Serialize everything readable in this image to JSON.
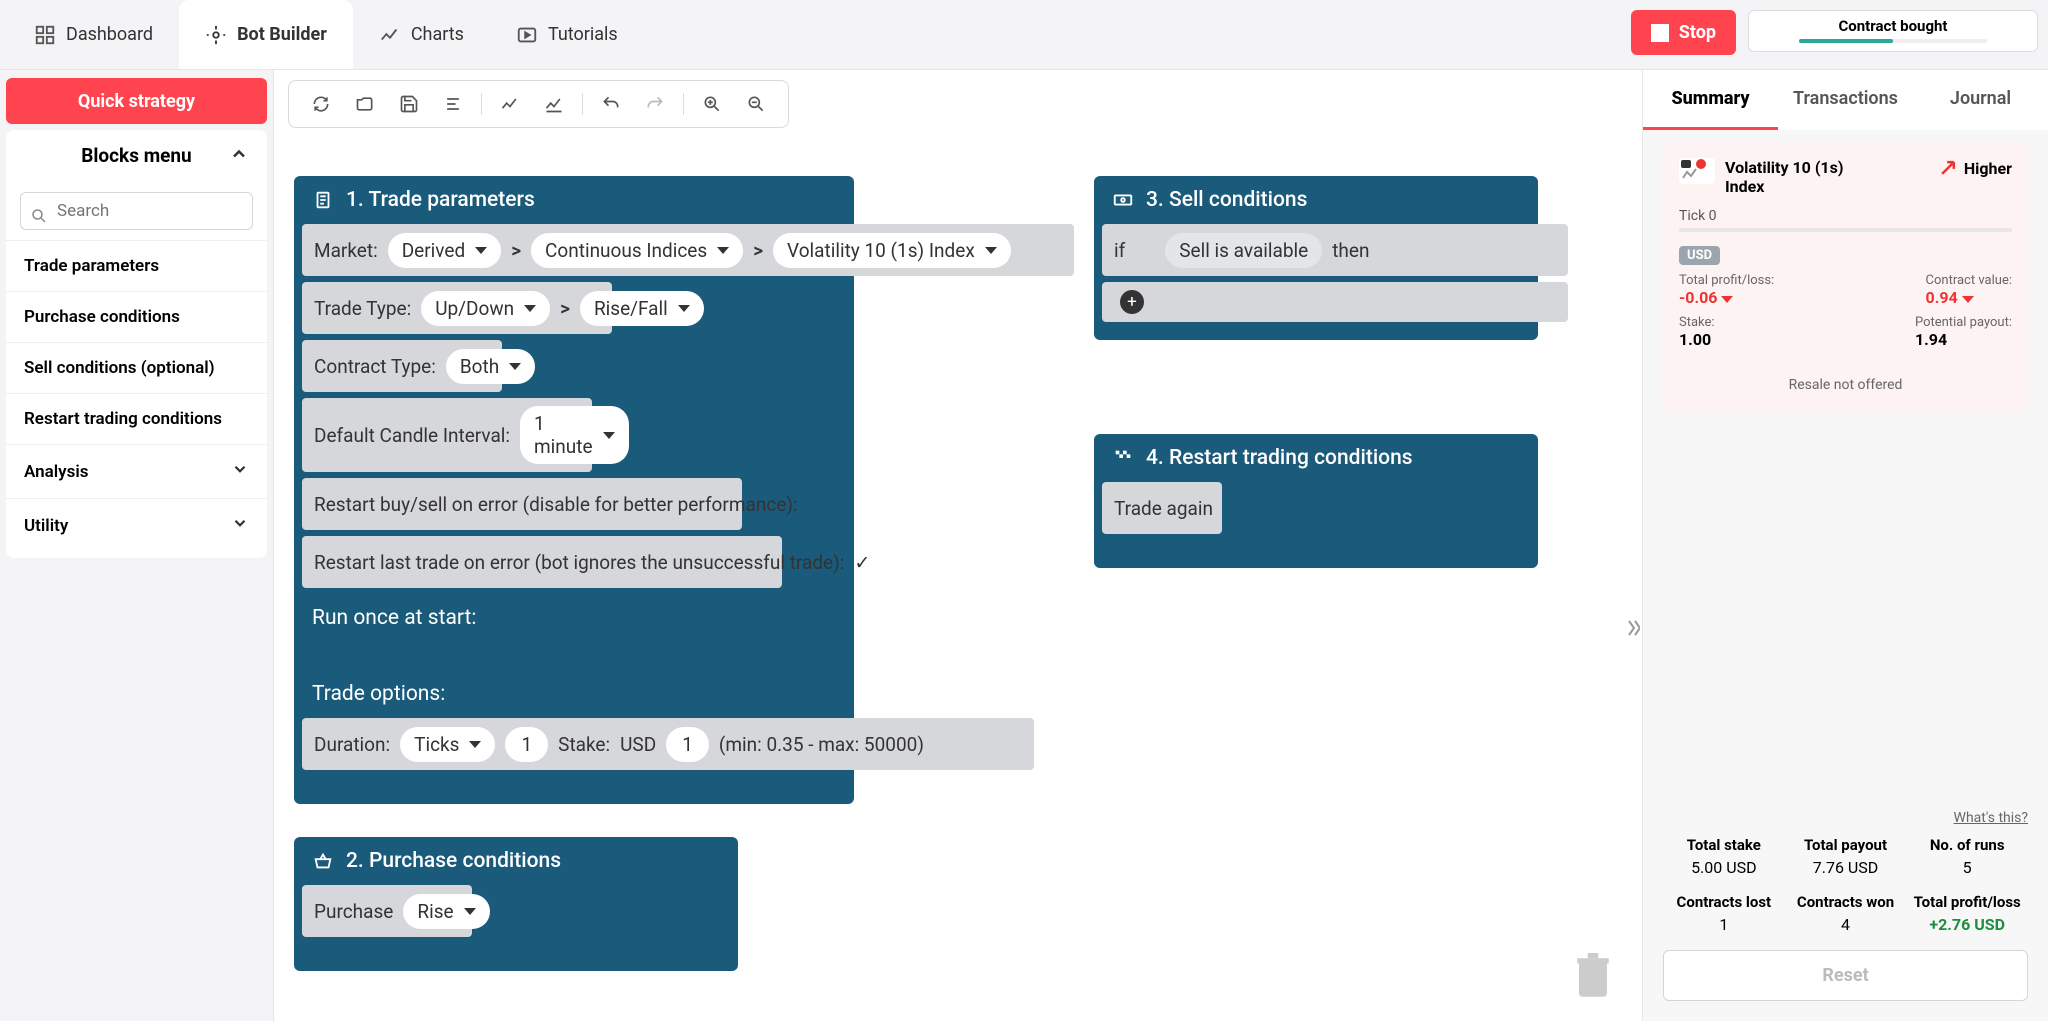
{
  "nav": {
    "dashboard": "Dashboard",
    "bot_builder": "Bot Builder",
    "charts": "Charts",
    "tutorials": "Tutorials"
  },
  "top_actions": {
    "stop": "Stop",
    "status_title": "Contract bought"
  },
  "left": {
    "quick": "Quick strategy",
    "blocks_header": "Blocks menu",
    "search_placeholder": "Search",
    "items": {
      "trade_parameters": "Trade parameters",
      "purchase_conditions": "Purchase conditions",
      "sell_conditions": "Sell conditions (optional)",
      "restart": "Restart trading conditions",
      "analysis": "Analysis",
      "utility": "Utility"
    }
  },
  "blocks": {
    "b1": {
      "title": "1. Trade parameters",
      "market_lbl": "Market:",
      "market_v1": "Derived",
      "market_v2": "Continuous Indices",
      "market_v3": "Volatility 10 (1s) Index",
      "trade_type_lbl": "Trade Type:",
      "trade_type_v1": "Up/Down",
      "trade_type_v2": "Rise/Fall",
      "contract_type_lbl": "Contract Type:",
      "contract_type_v": "Both",
      "candle_lbl": "Default Candle Interval:",
      "candle_v": "1 minute",
      "restart_buysell": "Restart buy/sell on error (disable for better performance):",
      "restart_last": "Restart last trade on error (bot ignores the unsuccessful trade):",
      "restart_last_chk": "✓",
      "run_once": "Run once at start:",
      "trade_options": "Trade options:",
      "duration_lbl": "Duration:",
      "duration_unit": "Ticks",
      "duration_val": "1",
      "stake_lbl": "Stake:",
      "stake_cur": "USD",
      "stake_val": "1",
      "stake_range": "(min: 0.35 - max: 50000)"
    },
    "b2": {
      "title": "2. Purchase conditions",
      "purchase_lbl": "Purchase",
      "purchase_v": "Rise"
    },
    "b3": {
      "title": "3. Sell conditions",
      "if": "if",
      "cond": "Sell is available",
      "then": "then"
    },
    "b4": {
      "title": "4. Restart trading conditions",
      "trade_again": "Trade again"
    }
  },
  "right": {
    "tabs": {
      "summary": "Summary",
      "transactions": "Transactions",
      "journal": "Journal"
    },
    "card": {
      "index_title": "Volatility 10 (1s) Index",
      "direction": "Higher",
      "tick_lbl": "Tick 0",
      "usd_badge": "USD",
      "pl_lbl": "Total profit/loss:",
      "pl_val": "-0.06",
      "cval_lbl": "Contract value:",
      "cval_val": "0.94",
      "stake_lbl": "Stake:",
      "stake_val": "1.00",
      "payout_lbl": "Potential payout:",
      "payout_val": "1.94",
      "resale": "Resale not offered"
    },
    "whats": "What's this?",
    "stats": {
      "total_stake_lbl": "Total stake",
      "total_stake_val": "5.00 USD",
      "total_payout_lbl": "Total payout",
      "total_payout_val": "7.76 USD",
      "runs_lbl": "No. of runs",
      "runs_val": "5",
      "lost_lbl": "Contracts lost",
      "lost_val": "1",
      "won_lbl": "Contracts won",
      "won_val": "4",
      "pl_lbl": "Total profit/loss",
      "pl_val": "+2.76 USD"
    },
    "reset": "Reset"
  }
}
